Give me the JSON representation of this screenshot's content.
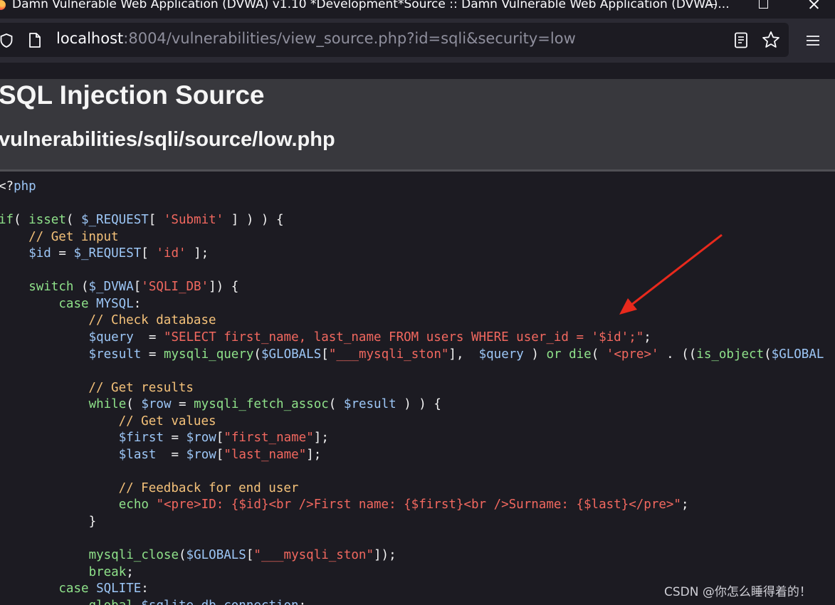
{
  "window": {
    "title": "Damn Vulnerable Web Application (DVWA) v1.10 *Development*Source :: Damn Vulnerable Web Application (DVWA)..."
  },
  "address_bar": {
    "host": "localhost",
    "path": ":8004/vulnerabilities/view_source.php?id=sqli&security=low"
  },
  "page": {
    "title": "SQL Injection Source",
    "subtitle": "vulnerabilities/sqli/source/low.php"
  },
  "code_lines": [
    "<?php",
    "",
    "if( isset( $_REQUEST[ 'Submit' ] ) ) {",
    "    // Get input",
    "    $id = $_REQUEST[ 'id' ];",
    "",
    "    switch ($_DVWA['SQLI_DB']) {",
    "        case MYSQL:",
    "            // Check database",
    "            $query  = \"SELECT first_name, last_name FROM users WHERE user_id = '$id';\";",
    "            $result = mysqli_query($GLOBALS[\"___mysqli_ston\"],  $query ) or die( '<pre>' . ((is_object($GLOBAL",
    "",
    "            // Get results",
    "            while( $row = mysqli_fetch_assoc( $result ) ) {",
    "                // Get values",
    "                $first = $row[\"first_name\"];",
    "                $last  = $row[\"last_name\"];",
    "",
    "                // Feedback for end user",
    "                echo \"<pre>ID: {$id}<br />First name: {$first}<br />Surname: {$last}</pre>\";",
    "            }",
    "",
    "            mysqli_close($GLOBALS[\"___mysqli_ston\"]);",
    "            break;",
    "        case SQLITE:",
    "            global $sqlite_db_connection;"
  ],
  "watermark": "CSDN @你怎么睡得着的！",
  "colors": {
    "keyword": "#8fe28a",
    "string": "#f2685f",
    "comment": "#f5c27a",
    "variable": "#9dc7f7",
    "annotation_arrow": "#e8291c"
  }
}
